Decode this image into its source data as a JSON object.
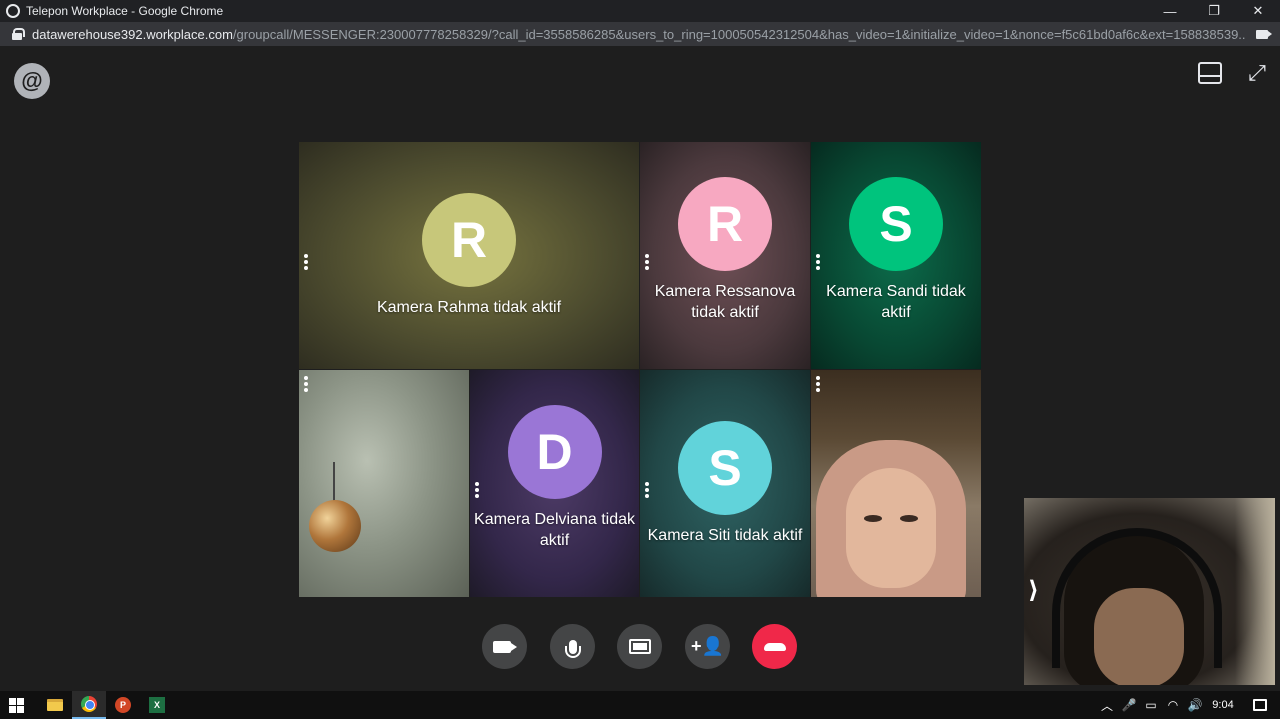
{
  "window": {
    "title": "Telepon Workplace - Google Chrome",
    "minimize_glyph": "—",
    "restore_glyph": "❐",
    "close_glyph": "✕"
  },
  "address_bar": {
    "host": "datawerehouse392.workplace.com",
    "path": "/groupcall/MESSENGER:2300077782583​29/?call_id=3558586285&users_to_ring=100050542312504&has_video=1&initialize_video=1&nonce=f5c61bd0af6c&ext=158838539..."
  },
  "header": {
    "logo_letter": "@",
    "expand_glyph": "⤢"
  },
  "tiles": [
    {
      "avatar_letter": "R",
      "avatar_color": "#c7c77a",
      "label": "Kamera Rahma tidak aktif"
    },
    {
      "avatar_letter": "R",
      "avatar_color": "#f7a8c1",
      "label": "Kamera Ressanova tidak aktif"
    },
    {
      "avatar_letter": "S",
      "avatar_color": "#00c47d",
      "label": "Kamera Sandi tidak aktif"
    },
    {
      "avatar_letter": "D",
      "avatar_color": "#9a76d6",
      "label": "Kamera Delviana tidak aktif"
    },
    {
      "avatar_letter": "S",
      "avatar_color": "#61d3da",
      "label": "Kamera Siti tidak aktif"
    }
  ],
  "self_view": {
    "collapse_glyph": "⟩"
  },
  "controls": {
    "add_glyph": "+👤"
  },
  "taskbar": {
    "ppt_letter": "P",
    "xls_letter": "X",
    "tray_up_glyph": "︿",
    "mic_glyph": "🎤",
    "battery_glyph": "▭",
    "wifi_glyph": "◠",
    "volume_glyph": "🔊",
    "time": "9:04"
  }
}
